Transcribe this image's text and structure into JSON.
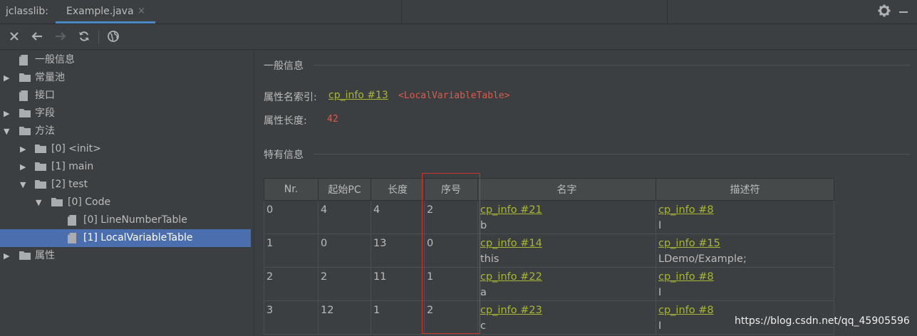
{
  "tabbar": {
    "app_label": "jclasslib:",
    "tab_label": "Example.java",
    "tab_close": "×"
  },
  "toolbar": {
    "icons": [
      "close-icon",
      "back-arrow-icon",
      "forward-arrow-icon",
      "refresh-icon",
      "globe-icon"
    ]
  },
  "tree": [
    {
      "label": "一般信息",
      "icon": "file-icon",
      "expander": ""
    },
    {
      "label": "常量池",
      "icon": "folder-icon",
      "expander": "▶"
    },
    {
      "label": "接口",
      "icon": "file-icon",
      "expander": ""
    },
    {
      "label": "字段",
      "icon": "folder-icon",
      "expander": "▶"
    },
    {
      "label": "方法",
      "icon": "folder-icon",
      "expander": "▼"
    },
    {
      "label": "[0] <init>",
      "icon": "folder-icon",
      "expander": "▶"
    },
    {
      "label": "[1] main",
      "icon": "folder-icon",
      "expander": "▶"
    },
    {
      "label": "[2] test",
      "icon": "folder-icon",
      "expander": "▼"
    },
    {
      "label": "[0] Code",
      "icon": "folder-icon",
      "expander": "▼"
    },
    {
      "label": "[0] LineNumberTable",
      "icon": "file-icon",
      "expander": ""
    },
    {
      "label": "[1] LocalVariableTable",
      "icon": "file-icon",
      "expander": ""
    },
    {
      "label": "属性",
      "icon": "folder-icon",
      "expander": "▶"
    }
  ],
  "general": {
    "title": "一般信息",
    "name_index_label": "属性名索引:",
    "name_index_link": "cp_info #13",
    "name_index_value": "<LocalVariableTable>",
    "length_label": "属性长度:",
    "length_value": "42"
  },
  "specific": {
    "title": "特有信息",
    "columns": [
      "Nr.",
      "起始PC",
      "长度",
      "序号",
      "名字",
      "描述符"
    ],
    "rows": [
      {
        "nr": "0",
        "start_pc": "4",
        "length": "4",
        "index": "2",
        "name_link": "cp_info #21",
        "name": "b",
        "desc_link": "cp_info #8",
        "desc": "I"
      },
      {
        "nr": "1",
        "start_pc": "0",
        "length": "13",
        "index": "0",
        "name_link": "cp_info #14",
        "name": "this",
        "desc_link": "cp_info #15",
        "desc": "LDemo/Example;"
      },
      {
        "nr": "2",
        "start_pc": "2",
        "length": "11",
        "index": "1",
        "name_link": "cp_info #22",
        "name": "a",
        "desc_link": "cp_info #8",
        "desc": "I"
      },
      {
        "nr": "3",
        "start_pc": "12",
        "length": "1",
        "index": "2",
        "name_link": "cp_info #23",
        "name": "c",
        "desc_link": "cp_info #8",
        "desc": "I"
      }
    ]
  },
  "watermark": "https://blog.csdn.net/qq_45905596",
  "colors": {
    "background": "#3c3f41",
    "selection": "#4b6eaf",
    "link": "#a9b731",
    "value": "#d75c4f",
    "highlight_box": "#c8362d"
  }
}
